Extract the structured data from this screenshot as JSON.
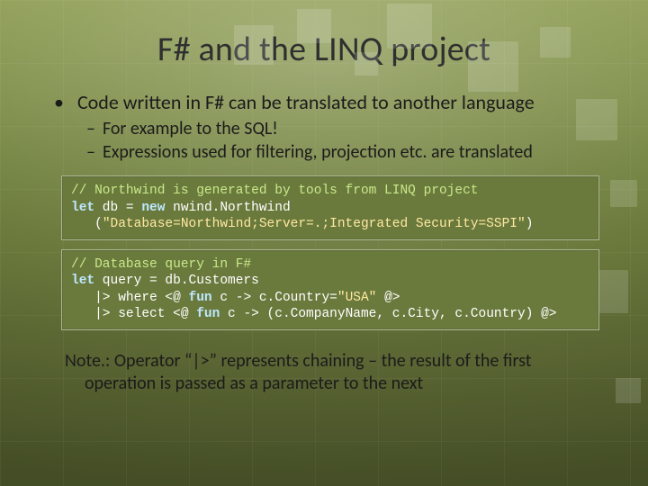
{
  "title": "F# and the LINQ project",
  "bullet_main": "Code written in F# can be translated to another language",
  "sub1": "For example to the SQL!",
  "sub2": "Expressions used for filtering, projection etc. are translated",
  "code1": {
    "l1_comment": "// Northwind is generated by tools from LINQ project",
    "l2_let": "let",
    "l2_rest_a": " db = ",
    "l2_new": "new",
    "l2_rest_b": " nwind.Northwind",
    "l3_indent": "   (",
    "l3_str": "\"Database=Northwind;Server=.;Integrated Security=SSPI\"",
    "l3_close": ")"
  },
  "code2": {
    "l1_comment": "// Database query in F#",
    "l2_let": "let",
    "l2_rest": " query = db.Customers",
    "l3_a": "   |> where <@ ",
    "l3_fun": "fun",
    "l3_b": " c -> c.Country=",
    "l3_str": "\"USA\"",
    "l3_c": " @>",
    "l4_a": "   |> select <@ ",
    "l4_fun": "fun",
    "l4_b": " c -> (c.CompanyName, c.City, c.Country) @>"
  },
  "note": "Note.: Operator “|>” represents chaining – the result of the first operation is passed as a parameter to the next"
}
